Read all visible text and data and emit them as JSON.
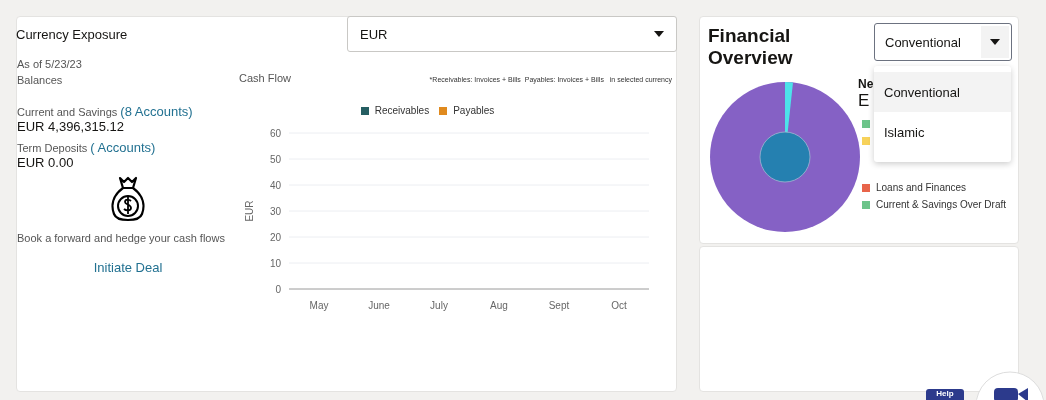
{
  "currency_exposure": {
    "title": "Currency Exposure",
    "currency_select": {
      "value": "EUR"
    },
    "as_of": "As of 5/23/23",
    "balances_label": "Balances",
    "balances": [
      {
        "label": "Current and Savings",
        "link": "(8 Accounts)",
        "amount": "EUR 4,396,315.12"
      },
      {
        "label": "Term Deposits",
        "link": "( Accounts)",
        "amount": "EUR 0.00"
      }
    ],
    "promo": "Book a forward and hedge your cash flows",
    "action": "Initiate Deal",
    "cash_flow": {
      "title": "Cash Flow",
      "note": "*Receivables: Invoices + Bills  Payables: Invoices + Bills   in selected currency",
      "chart_data": {
        "type": "bar",
        "ylabel": "EUR",
        "categories": [
          "May",
          "June",
          "July",
          "Aug",
          "Sept",
          "Oct"
        ],
        "ylim": [
          0,
          60
        ],
        "grid": true,
        "yticks": [
          0,
          10,
          20,
          30,
          40,
          50,
          60
        ],
        "series": [
          {
            "name": "Receivables",
            "color": "#255e62",
            "values": [
              null,
              null,
              null,
              null,
              null,
              null
            ]
          },
          {
            "name": "Payables",
            "color": "#e08a1e",
            "values": [
              null,
              null,
              null,
              null,
              null,
              null
            ]
          }
        ]
      }
    }
  },
  "financial_overview": {
    "title": "Financial Overview",
    "type_select": {
      "value": "Conventional",
      "expanded": true,
      "options": [
        {
          "label": "Conventional",
          "selected": true
        },
        {
          "label": "Islamic",
          "selected": false
        }
      ]
    },
    "net_label": "Ne",
    "net_amount": "E",
    "legend": [
      {
        "color": "#6cc48a"
      },
      {
        "color": "#f7d25a"
      },
      {
        "label": "Loans and Finances",
        "color": "#e8644a"
      },
      {
        "label": "Current & Savings Over Draft",
        "color": "#6cc48a"
      }
    ]
  },
  "help": {
    "label": "Help"
  }
}
